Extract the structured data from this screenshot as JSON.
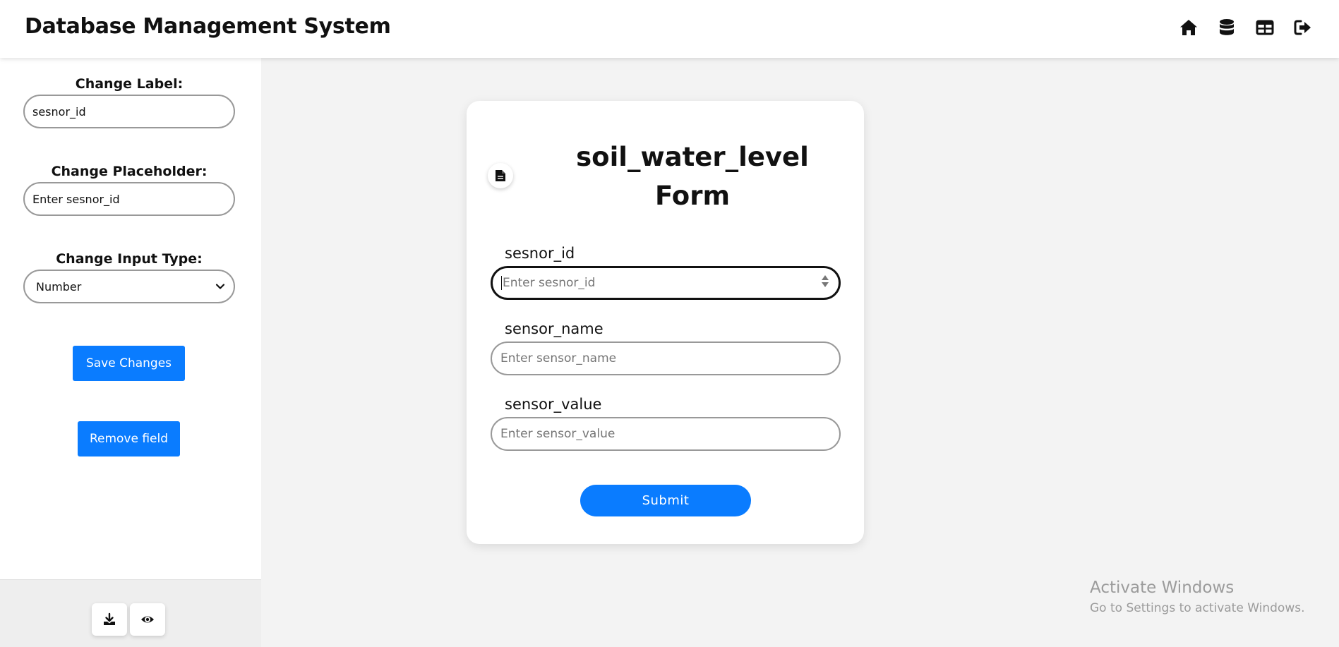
{
  "app": {
    "title": "Database Management System"
  },
  "topnav": {
    "icons": [
      "home-icon",
      "database-icon",
      "table-icon",
      "logout-icon"
    ]
  },
  "sidebar": {
    "label_heading": "Change Label:",
    "label_value": "sesnor_id",
    "placeholder_heading": "Change Placeholder:",
    "placeholder_value": "Enter sesnor_id",
    "input_type_heading": "Change Input Type:",
    "input_type_value": "Number",
    "save_button": "Save Changes",
    "remove_button": "Remove field"
  },
  "form": {
    "title": "soil_water_level Form",
    "fields": [
      {
        "label": "sesnor_id",
        "placeholder": "Enter sesnor_id",
        "focused": true
      },
      {
        "label": "sensor_name",
        "placeholder": "Enter sensor_name",
        "focused": false
      },
      {
        "label": "sensor_value",
        "placeholder": "Enter sensor_value",
        "focused": false
      }
    ],
    "submit": "Submit"
  },
  "watermark": {
    "title": "Activate Windows",
    "subtitle": "Go to Settings to activate Windows."
  },
  "colors": {
    "accent": "#0a7cff",
    "background": "#f3f3f3"
  }
}
